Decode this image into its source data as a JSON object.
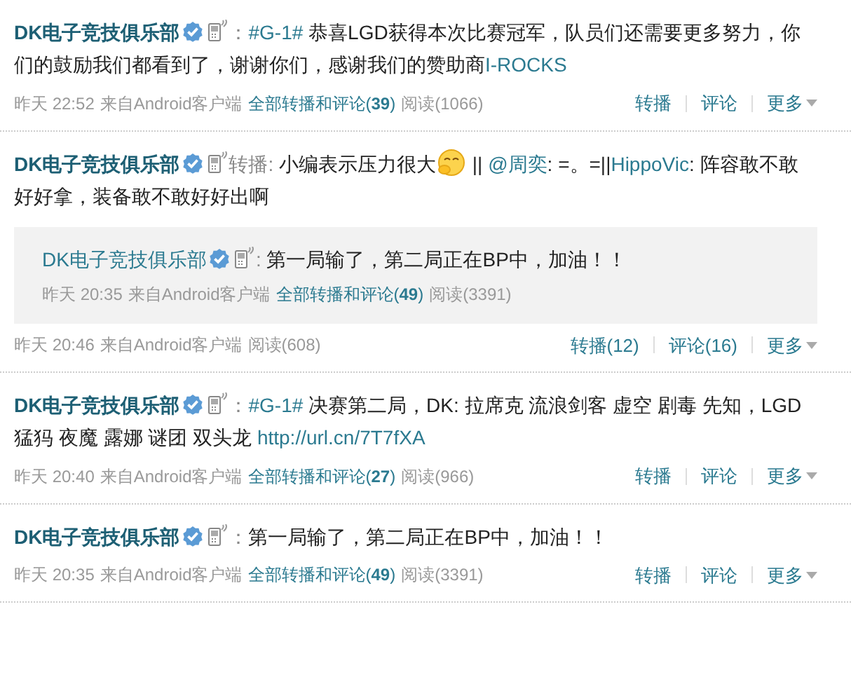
{
  "posts": [
    {
      "author": "DK电子竞技俱乐部",
      "verified": true,
      "mobile": true,
      "parts": [
        {
          "kind": "muted",
          "text": "："
        },
        {
          "kind": "link",
          "text": "#G-1#"
        },
        {
          "kind": "plain",
          "text": " 恭喜LGD获得本次比赛冠军，队员们还需要更多努力，你们的鼓励我们都看到了，谢谢你们，感谢我们的赞助商"
        },
        {
          "kind": "link",
          "text": "I-ROCKS"
        }
      ],
      "meta": {
        "time": "昨天 22:52",
        "source": "来自Android客户端",
        "all": "全部转播和评论(**39**)",
        "reads": "阅读(1066)"
      },
      "actions": [
        {
          "kind": "link",
          "text": "转播"
        },
        {
          "kind": "link",
          "text": "评论"
        },
        {
          "kind": "menu",
          "text": "更多"
        }
      ]
    },
    {
      "author": "DK电子竞技俱乐部",
      "verified": true,
      "mobile": true,
      "parts": [
        {
          "kind": "muted",
          "text": "转播:"
        },
        {
          "kind": "plain",
          "text": " 小编表示压力很大"
        },
        {
          "kind": "emoji"
        },
        {
          "kind": "plain",
          "text": " || "
        },
        {
          "kind": "link",
          "text": "@周奕"
        },
        {
          "kind": "plain",
          "text": ": =。=||"
        },
        {
          "kind": "link",
          "text": "HippoVic"
        },
        {
          "kind": "plain",
          "text": ": 阵容敢不敢好好拿，装备敢不敢好好出啊"
        }
      ],
      "repost": {
        "author": "DK电子竞技俱乐部",
        "verified": true,
        "mobile": true,
        "parts": [
          {
            "kind": "muted",
            "text": ":"
          },
          {
            "kind": "plain",
            "text": " 第一局输了，第二局正在BP中，加油！！"
          }
        ],
        "meta": {
          "time": "昨天 20:35",
          "source": "来自Android客户端",
          "all": "全部转播和评论(**49**)",
          "reads": "阅读(3391)"
        }
      },
      "meta": {
        "time": "昨天 20:46",
        "source": "来自Android客户端",
        "reads": "阅读(608)"
      },
      "actions": [
        {
          "kind": "link",
          "text": "转播(12)"
        },
        {
          "kind": "link",
          "text": "评论(16)"
        },
        {
          "kind": "menu",
          "text": "更多"
        }
      ]
    },
    {
      "author": "DK电子竞技俱乐部",
      "verified": true,
      "mobile": true,
      "parts": [
        {
          "kind": "muted",
          "text": "："
        },
        {
          "kind": "link",
          "text": "#G-1#"
        },
        {
          "kind": "plain",
          "text": " 决赛第二局，DK: 拉席克  流浪剑客  虚空  剧毒  先知，LGD 猛犸  夜魔  露娜  谜团  双头龙 "
        },
        {
          "kind": "link",
          "text": "http://url.cn/7T7fXA"
        }
      ],
      "meta": {
        "time": "昨天 20:40",
        "source": "来自Android客户端",
        "all": "全部转播和评论(**27**)",
        "reads": "阅读(966)"
      },
      "actions": [
        {
          "kind": "link",
          "text": "转播"
        },
        {
          "kind": "link",
          "text": "评论"
        },
        {
          "kind": "menu",
          "text": "更多"
        }
      ]
    },
    {
      "author": "DK电子竞技俱乐部",
      "verified": true,
      "mobile": true,
      "parts": [
        {
          "kind": "muted",
          "text": "："
        },
        {
          "kind": "plain",
          "text": "第一局输了，第二局正在BP中，加油！！"
        }
      ],
      "meta": {
        "time": "昨天 20:35",
        "source": "来自Android客户端",
        "all": "全部转播和评论(**49**)",
        "reads": "阅读(3391)"
      },
      "actions": [
        {
          "kind": "link",
          "text": "转播"
        },
        {
          "kind": "link",
          "text": "评论"
        },
        {
          "kind": "menu",
          "text": "更多"
        }
      ]
    }
  ]
}
